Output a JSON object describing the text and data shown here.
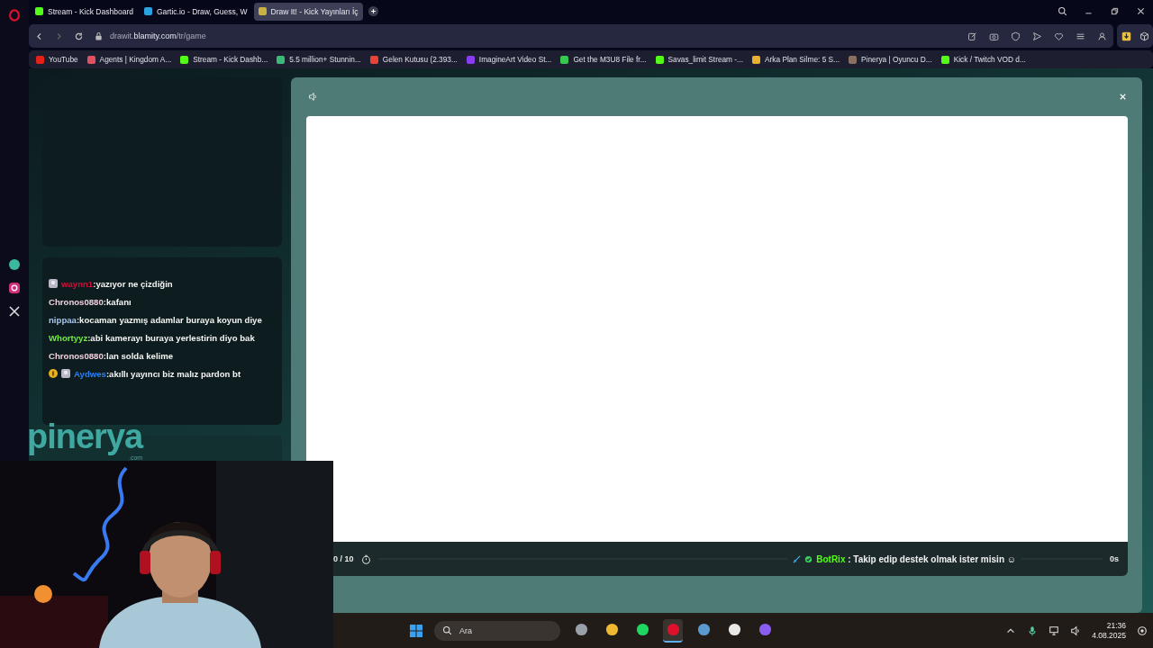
{
  "browser": {
    "tabs": [
      {
        "title": "Stream - Kick Dashboard",
        "selected": false
      },
      {
        "title": "Gartic.io - Draw, Guess, W",
        "selected": false
      },
      {
        "title": "Draw It! - Kick Yayınları İç",
        "selected": true
      }
    ],
    "address": {
      "host": "drawit.",
      "domain": "blamity.com",
      "path": "/tr/game"
    },
    "bookmarks": [
      "YouTube",
      "Agents | Kingdom A...",
      "Stream - Kick Dashb...",
      "5.5 million+ Stunnin...",
      "Gelen Kutusu (2.393...",
      "ImagineArt Video St...",
      "Get the M3U8 File fr...",
      "Savas_limit Stream -...",
      "Arka Plan Silme: 5 S...",
      "Pinerya | Oyuncu D...",
      "Kick / Twitch VOD d..."
    ]
  },
  "chat": [
    {
      "kind": "avatar",
      "user": "waynn1",
      "text": ":yazıyor ne çizdiğin",
      "color": "#d0103a"
    },
    {
      "kind": "plain",
      "user": "Chronos0880",
      "text": ":kafanı",
      "color": "#f2d0e0"
    },
    {
      "kind": "plain",
      "user": "nippaa",
      "text": ":kocaman yazmış adamlar buraya koyun diye",
      "color": "#a8c4f0"
    },
    {
      "kind": "plain",
      "user": "Whortyyz",
      "text": ":abi kamerayı buraya yerlestirin diyo bak",
      "color": "#6cf03c"
    },
    {
      "kind": "plain",
      "user": "Chronos0880",
      "text": ":lan solda kelime",
      "color": "#f2d0e0"
    },
    {
      "kind": "coin_avatar",
      "user": "Aydwes",
      "text": ":akıllı yayıncı biz malız pardon bt",
      "color": "#2f7ff0"
    }
  ],
  "overlay": {
    "logo": "pinerya",
    "logo_suffix": ".com"
  },
  "game": {
    "round": "0 / 10",
    "timer": "0s",
    "message": {
      "user": "BotRix",
      "text": " : Takip edip destek olmak ister misin ☺"
    }
  },
  "taskbar": {
    "search": {
      "placeholder": "Ara"
    },
    "apps": [
      {
        "selected": false
      },
      {
        "selected": false
      },
      {
        "selected": false
      },
      {
        "selected": true
      },
      {
        "selected": false
      },
      {
        "selected": false
      },
      {
        "selected": false
      }
    ],
    "time": "21:36",
    "date": "4.08.2025"
  }
}
